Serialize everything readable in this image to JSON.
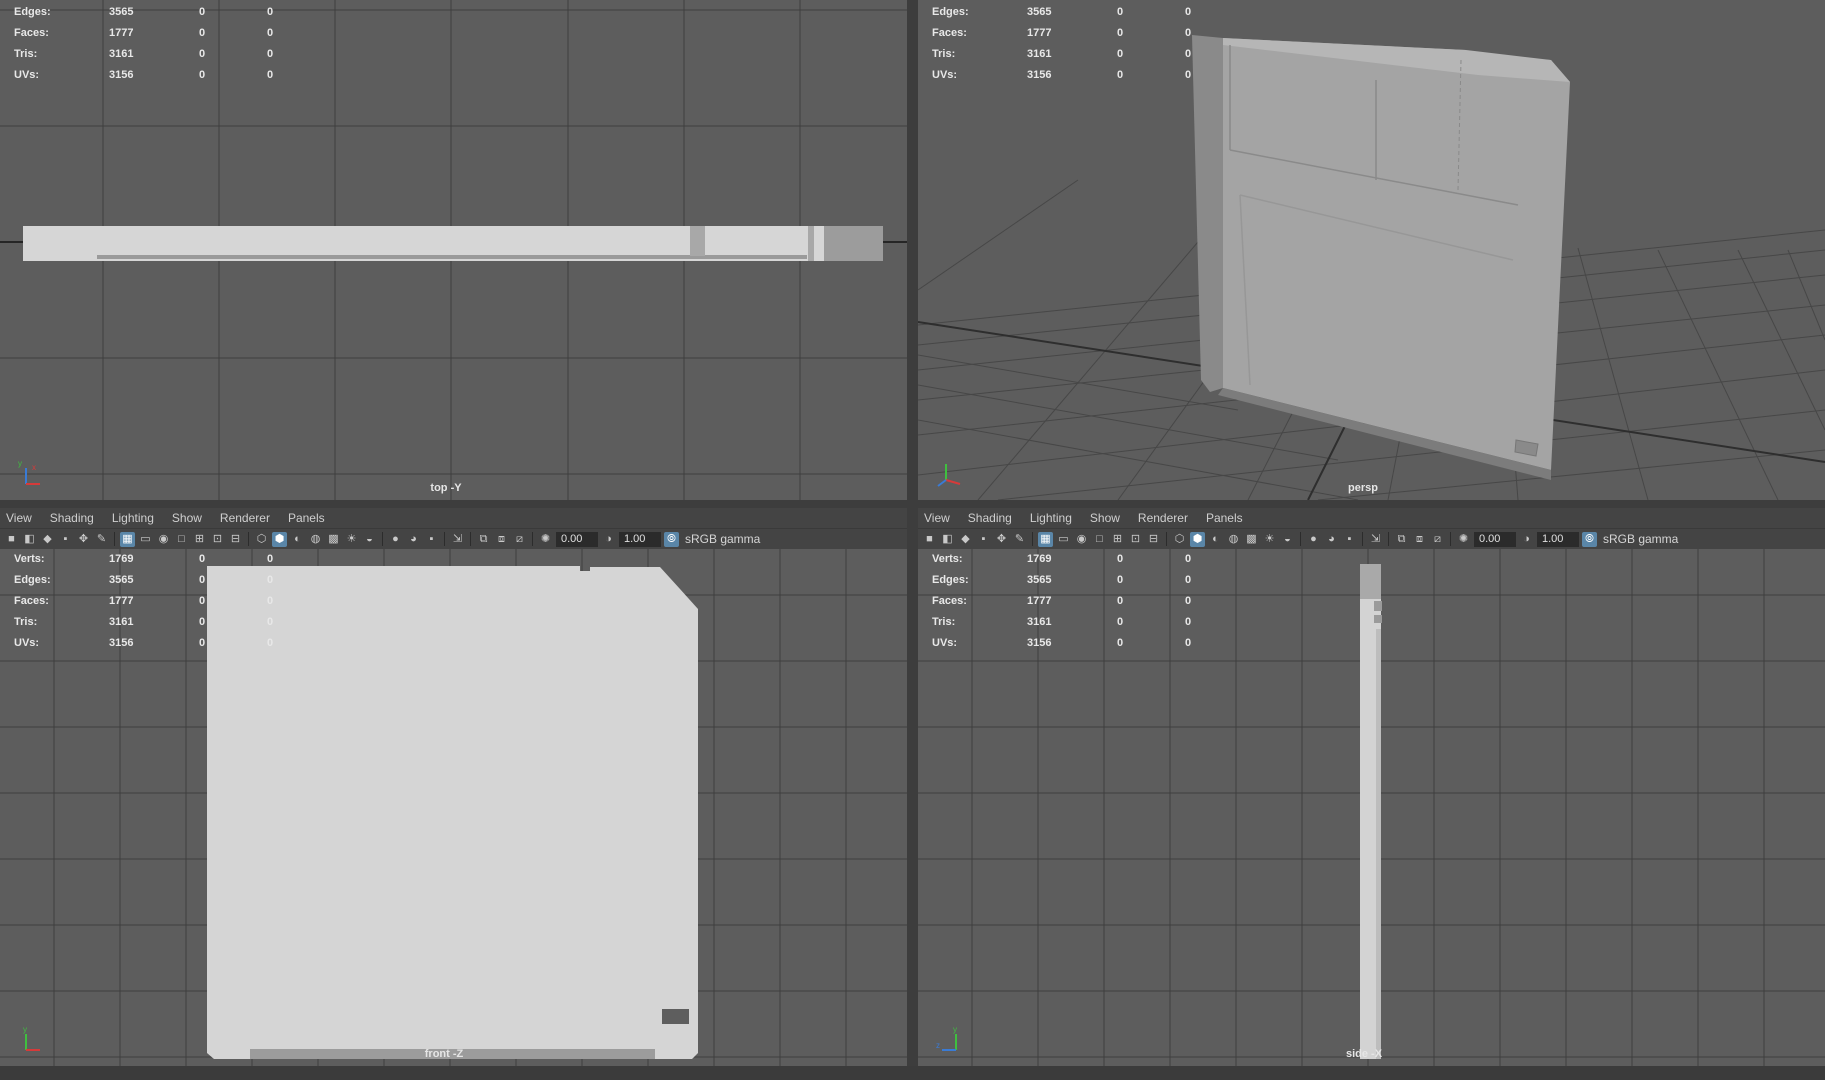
{
  "menus": [
    "View",
    "Shading",
    "Lighting",
    "Show",
    "Renderer",
    "Panels"
  ],
  "toolbar": {
    "field1": "0.00",
    "field2": "1.00",
    "color_space": "sRGB gamma"
  },
  "hud_rows": [
    {
      "label": "Verts:",
      "v1": "1769",
      "v2": "0",
      "v3": "0"
    },
    {
      "label": "Edges:",
      "v1": "3565",
      "v2": "0",
      "v3": "0"
    },
    {
      "label": "Faces:",
      "v1": "1777",
      "v2": "0",
      "v3": "0"
    },
    {
      "label": "Tris:",
      "v1": "3161",
      "v2": "0",
      "v3": "0"
    },
    {
      "label": "UVs:",
      "v1": "3156",
      "v2": "0",
      "v3": "0"
    }
  ],
  "panels": {
    "top": {
      "camera": "top -Y"
    },
    "persp": {
      "camera": "persp"
    },
    "front": {
      "camera": "front -Z"
    },
    "side": {
      "camera": "side -X"
    }
  },
  "colors": {
    "viewport_bg": "#5d5d5d",
    "grid": "#3f3f3f",
    "model": "#d4d4d4",
    "accent": "#5a86a8"
  },
  "icons": [
    "camera-icon",
    "grid-icon",
    "shaded-icon",
    "light-icon",
    "isolate-icon",
    "exposure-icon",
    "gamma-icon"
  ]
}
